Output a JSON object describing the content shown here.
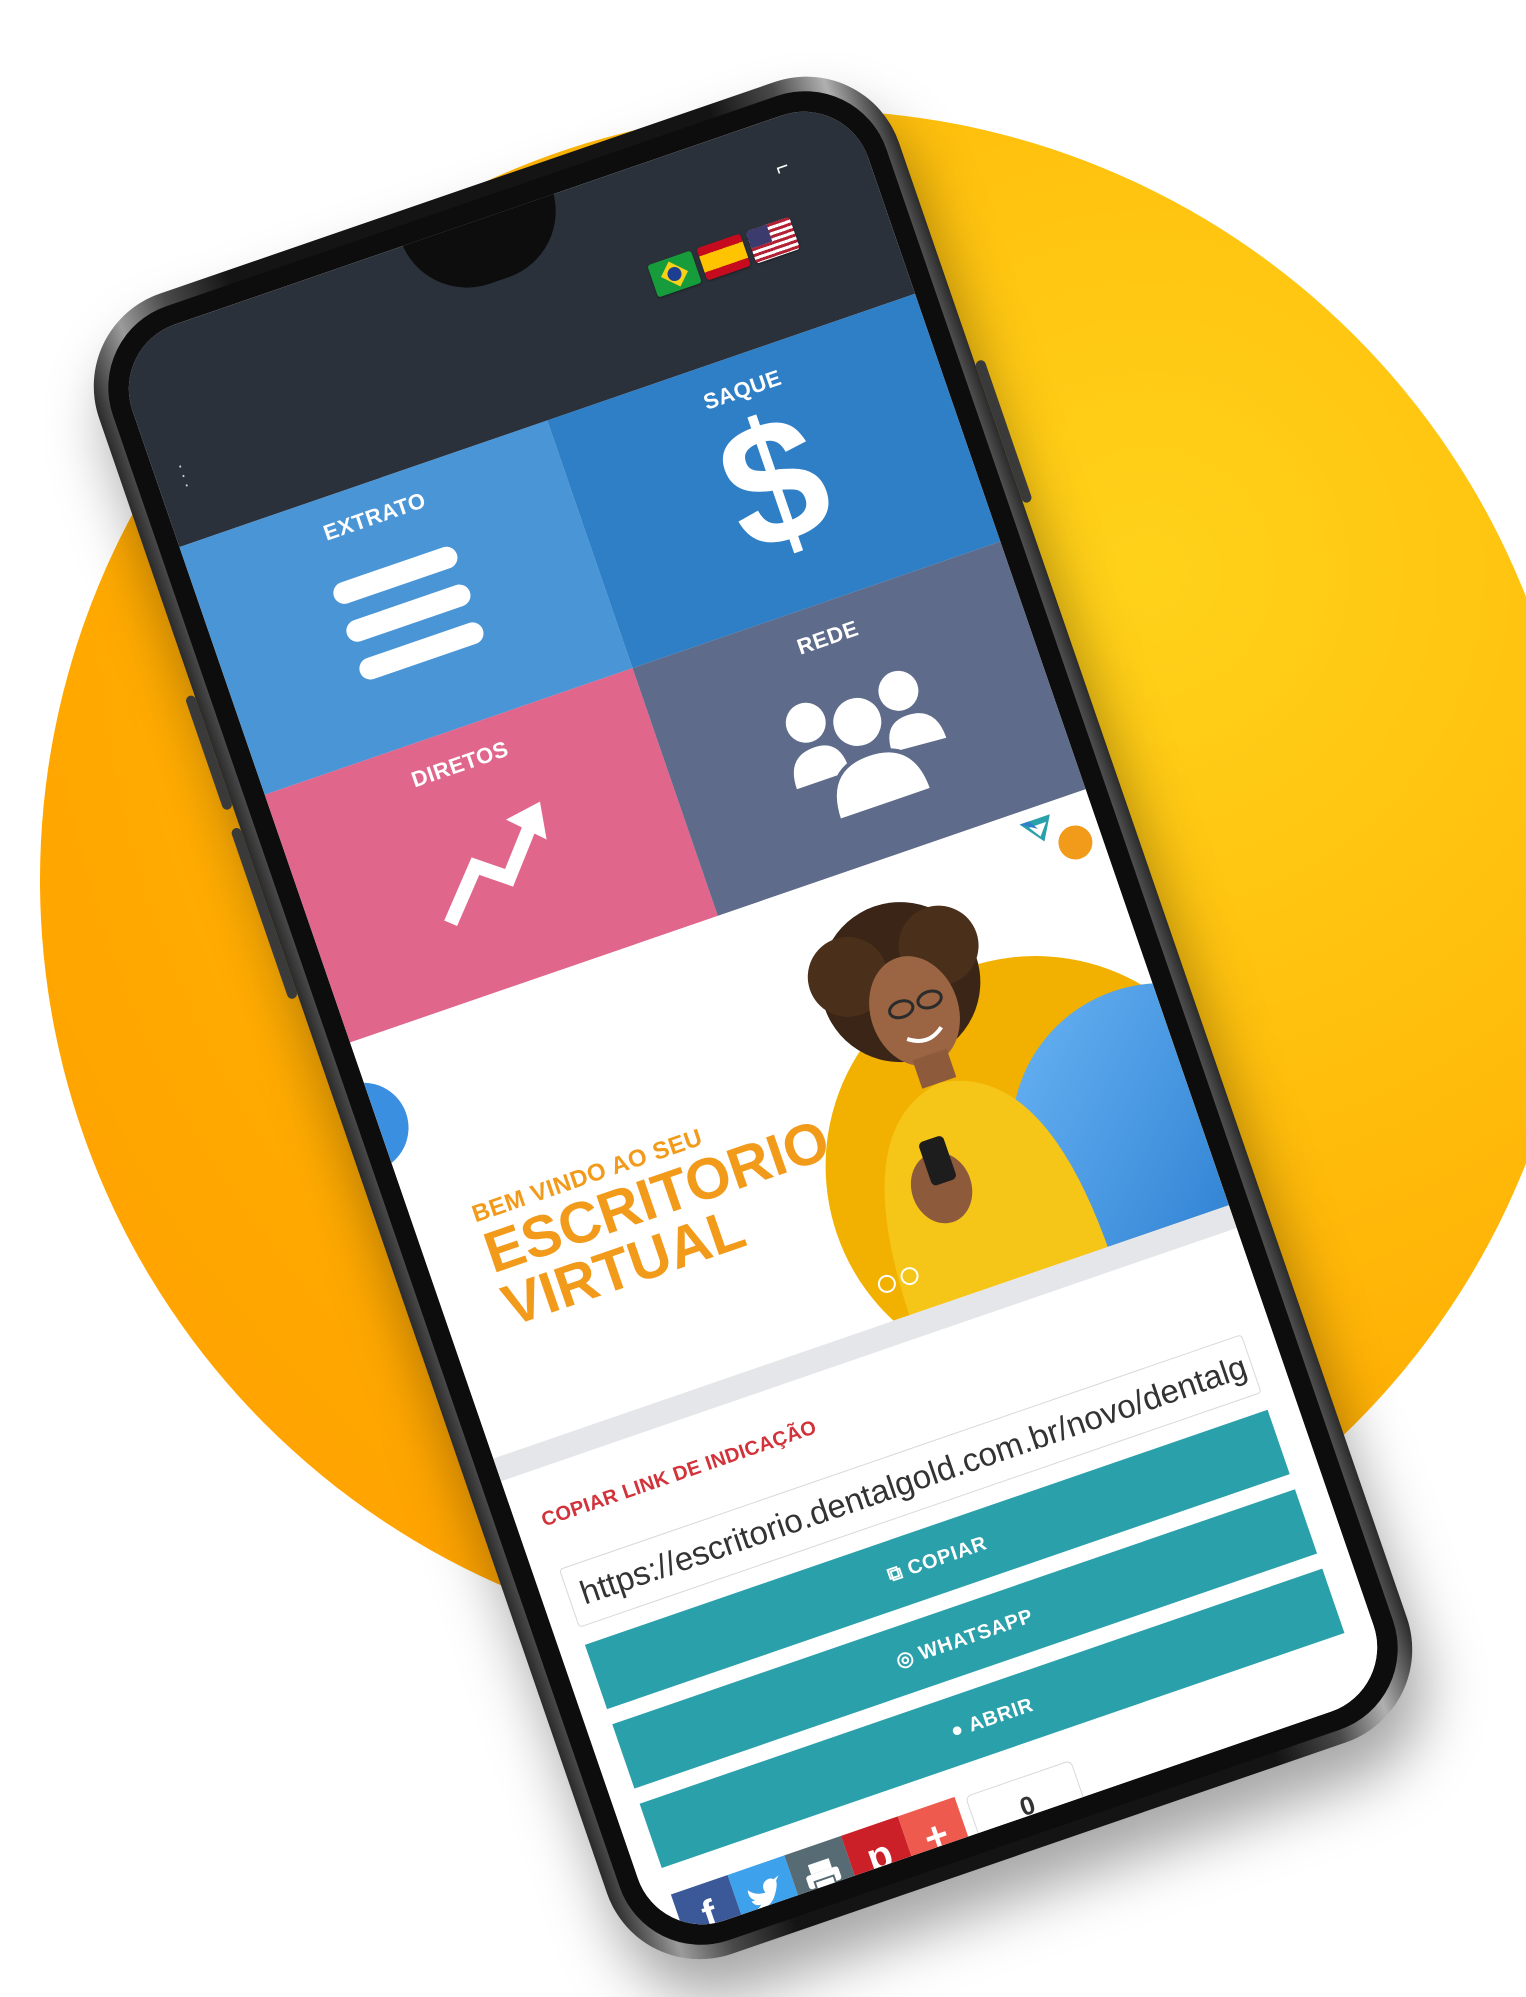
{
  "colors": {
    "background_circle": "#ffb000",
    "status_bar": "#2b313a",
    "tile_extrato": "#4a95d6",
    "tile_saque": "#2f7fc6",
    "tile_diretos": "#e0668c",
    "tile_rede": "#5e6b8a",
    "accent_orange": "#f29a1a",
    "link_label_red": "#d2323a",
    "button_teal": "#2aa0ab"
  },
  "status_bar": {
    "flags": [
      "brazil-flag-icon",
      "spain-flag-icon",
      "usa-flag-icon"
    ]
  },
  "tiles": {
    "saque": {
      "label": "SAQUE",
      "icon": "dollar-icon",
      "glyph": "$"
    },
    "extrato": {
      "label": "EXTRATO",
      "icon": "list-icon"
    },
    "rede": {
      "label": "REDE",
      "icon": "group-icon"
    },
    "diretos": {
      "label": "DIRETOS",
      "icon": "trending-up-icon"
    }
  },
  "banner": {
    "line1": "BEM VINDO AO SEU",
    "line2": "ESCRITORIO",
    "line3": "VIRTUAL"
  },
  "referral": {
    "label": "COPIAR LINK DE INDICAÇÃO",
    "link_value": "https://escritorio.dentalgold.com.br/novo/dentalg",
    "copy_button": "COPIAR",
    "whatsapp_button": "WHATSAPP",
    "open_button": "ABRIR"
  },
  "share": {
    "icons": [
      "facebook-icon",
      "twitter-icon",
      "print-icon",
      "pinterest-icon",
      "plus-icon"
    ],
    "count": "0"
  }
}
